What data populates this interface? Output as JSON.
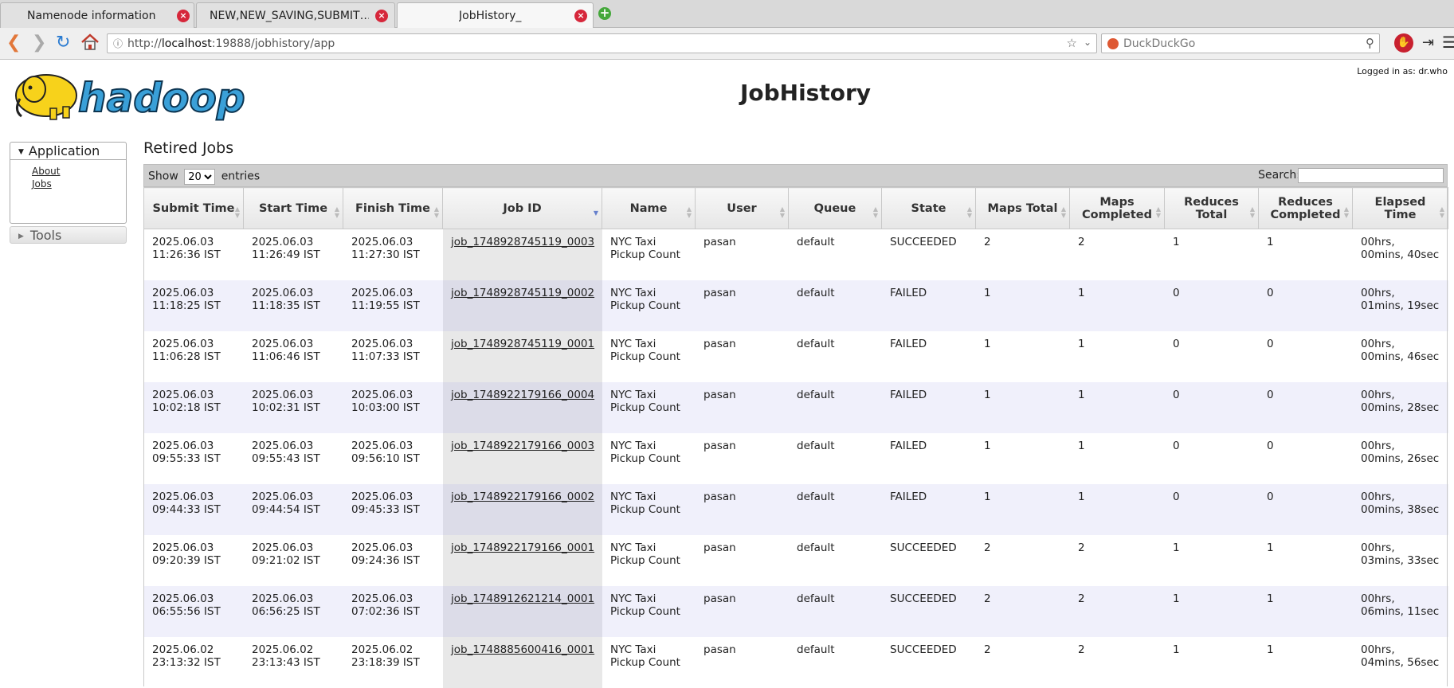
{
  "browser": {
    "tabs": [
      {
        "title": "Namenode information",
        "active": false
      },
      {
        "title": "NEW,NEW_SAVING,SUBMIT…",
        "active": false
      },
      {
        "title": "JobHistory_",
        "active": true
      }
    ],
    "url_prefix": "http://",
    "url_host": "localhost",
    "url_rest": ":19888/jobhistory/app",
    "search_placeholder": "DuckDuckGo"
  },
  "header": {
    "logged_in": "Logged in as: dr.who",
    "title": "JobHistory",
    "logo_text": "hadoop"
  },
  "nav": {
    "application_label": "Application",
    "links": [
      "About",
      "Jobs"
    ],
    "tools_label": "Tools"
  },
  "main": {
    "section_title": "Retired Jobs",
    "show_label": "Show",
    "entries_label": "entries",
    "page_size": "20",
    "search_label": "Search:",
    "columns": [
      "Submit Time",
      "Start Time",
      "Finish Time",
      "Job ID",
      "Name",
      "User",
      "Queue",
      "State",
      "Maps Total",
      "Maps Completed",
      "Reduces Total",
      "Reduces Completed",
      "Elapsed Time"
    ],
    "rows": [
      {
        "submit": "2025.06.03 11:26:36 IST",
        "start": "2025.06.03 11:26:49 IST",
        "finish": "2025.06.03 11:27:30 IST",
        "job_id": "job_1748928745119_0003",
        "name": "NYC Taxi Pickup Count",
        "user": "pasan",
        "queue": "default",
        "state": "SUCCEEDED",
        "maps_total": "2",
        "maps_completed": "2",
        "reduces_total": "1",
        "reduces_completed": "1",
        "elapsed": "00hrs, 00mins, 40sec"
      },
      {
        "submit": "2025.06.03 11:18:25 IST",
        "start": "2025.06.03 11:18:35 IST",
        "finish": "2025.06.03 11:19:55 IST",
        "job_id": "job_1748928745119_0002",
        "name": "NYC Taxi Pickup Count",
        "user": "pasan",
        "queue": "default",
        "state": "FAILED",
        "maps_total": "1",
        "maps_completed": "1",
        "reduces_total": "0",
        "reduces_completed": "0",
        "elapsed": "00hrs, 01mins, 19sec"
      },
      {
        "submit": "2025.06.03 11:06:28 IST",
        "start": "2025.06.03 11:06:46 IST",
        "finish": "2025.06.03 11:07:33 IST",
        "job_id": "job_1748928745119_0001",
        "name": "NYC Taxi Pickup Count",
        "user": "pasan",
        "queue": "default",
        "state": "FAILED",
        "maps_total": "1",
        "maps_completed": "1",
        "reduces_total": "0",
        "reduces_completed": "0",
        "elapsed": "00hrs, 00mins, 46sec"
      },
      {
        "submit": "2025.06.03 10:02:18 IST",
        "start": "2025.06.03 10:02:31 IST",
        "finish": "2025.06.03 10:03:00 IST",
        "job_id": "job_1748922179166_0004",
        "name": "NYC Taxi Pickup Count",
        "user": "pasan",
        "queue": "default",
        "state": "FAILED",
        "maps_total": "1",
        "maps_completed": "1",
        "reduces_total": "0",
        "reduces_completed": "0",
        "elapsed": "00hrs, 00mins, 28sec"
      },
      {
        "submit": "2025.06.03 09:55:33 IST",
        "start": "2025.06.03 09:55:43 IST",
        "finish": "2025.06.03 09:56:10 IST",
        "job_id": "job_1748922179166_0003",
        "name": "NYC Taxi Pickup Count",
        "user": "pasan",
        "queue": "default",
        "state": "FAILED",
        "maps_total": "1",
        "maps_completed": "1",
        "reduces_total": "0",
        "reduces_completed": "0",
        "elapsed": "00hrs, 00mins, 26sec"
      },
      {
        "submit": "2025.06.03 09:44:33 IST",
        "start": "2025.06.03 09:44:54 IST",
        "finish": "2025.06.03 09:45:33 IST",
        "job_id": "job_1748922179166_0002",
        "name": "NYC Taxi Pickup Count",
        "user": "pasan",
        "queue": "default",
        "state": "FAILED",
        "maps_total": "1",
        "maps_completed": "1",
        "reduces_total": "0",
        "reduces_completed": "0",
        "elapsed": "00hrs, 00mins, 38sec"
      },
      {
        "submit": "2025.06.03 09:20:39 IST",
        "start": "2025.06.03 09:21:02 IST",
        "finish": "2025.06.03 09:24:36 IST",
        "job_id": "job_1748922179166_0001",
        "name": "NYC Taxi Pickup Count",
        "user": "pasan",
        "queue": "default",
        "state": "SUCCEEDED",
        "maps_total": "2",
        "maps_completed": "2",
        "reduces_total": "1",
        "reduces_completed": "1",
        "elapsed": "00hrs, 03mins, 33sec"
      },
      {
        "submit": "2025.06.03 06:55:56 IST",
        "start": "2025.06.03 06:56:25 IST",
        "finish": "2025.06.03 07:02:36 IST",
        "job_id": "job_1748912621214_0001",
        "name": "NYC Taxi Pickup Count",
        "user": "pasan",
        "queue": "default",
        "state": "SUCCEEDED",
        "maps_total": "2",
        "maps_completed": "2",
        "reduces_total": "1",
        "reduces_completed": "1",
        "elapsed": "00hrs, 06mins, 11sec"
      },
      {
        "submit": "2025.06.02 23:13:32 IST",
        "start": "2025.06.02 23:13:43 IST",
        "finish": "2025.06.02 23:18:39 IST",
        "job_id": "job_1748885600416_0001",
        "name": "NYC Taxi Pickup Count",
        "user": "pasan",
        "queue": "default",
        "state": "SUCCEEDED",
        "maps_total": "2",
        "maps_completed": "2",
        "reduces_total": "1",
        "reduces_completed": "1",
        "elapsed": "00hrs, 04mins, 56sec"
      }
    ]
  },
  "colors": {
    "tab_close": "#d6273b",
    "new_tab": "#45a83b",
    "logo_blue": "#3aa0d8",
    "logo_yellow": "#f7d21b",
    "row_alt": "#f0f0fb",
    "sort_active": "#6680cc"
  }
}
